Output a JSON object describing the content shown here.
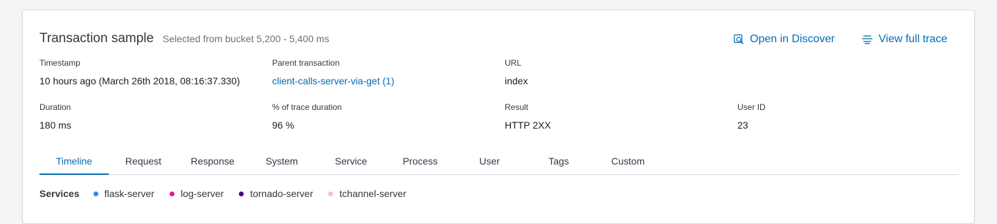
{
  "header": {
    "title": "Transaction sample",
    "subtitle": "Selected from bucket 5,200 - 5,400 ms"
  },
  "actions": {
    "discover_label": "Open in Discover",
    "discover_icon": "discover-icon",
    "trace_label": "View full trace",
    "trace_icon": "trace-icon",
    "link_color": "#006bb4"
  },
  "fields": {
    "timestamp": {
      "label": "Timestamp",
      "value": "10 hours ago (March 26th 2018, 08:16:37.330)"
    },
    "parent": {
      "label": "Parent transaction",
      "value": "client-calls-server-via-get (1)"
    },
    "url": {
      "label": "URL",
      "value": "index"
    },
    "duration": {
      "label": "Duration",
      "value": "180 ms"
    },
    "trace_pct": {
      "label": "% of trace duration",
      "value": "96 %"
    },
    "result": {
      "label": "Result",
      "value": "HTTP 2XX"
    },
    "user_id": {
      "label": "User ID",
      "value": "23"
    }
  },
  "tabs": [
    {
      "label": "Timeline",
      "active": true
    },
    {
      "label": "Request"
    },
    {
      "label": "Response"
    },
    {
      "label": "System"
    },
    {
      "label": "Service"
    },
    {
      "label": "Process"
    },
    {
      "label": "User"
    },
    {
      "label": "Tags"
    },
    {
      "label": "Custom"
    }
  ],
  "services": {
    "label": "Services",
    "items": [
      {
        "name": "flask-server",
        "color": "#3185fc"
      },
      {
        "name": "log-server",
        "color": "#e01b84"
      },
      {
        "name": "tornado-server",
        "color": "#490092"
      },
      {
        "name": "tchannel-server",
        "color": "#feb6db"
      }
    ]
  }
}
